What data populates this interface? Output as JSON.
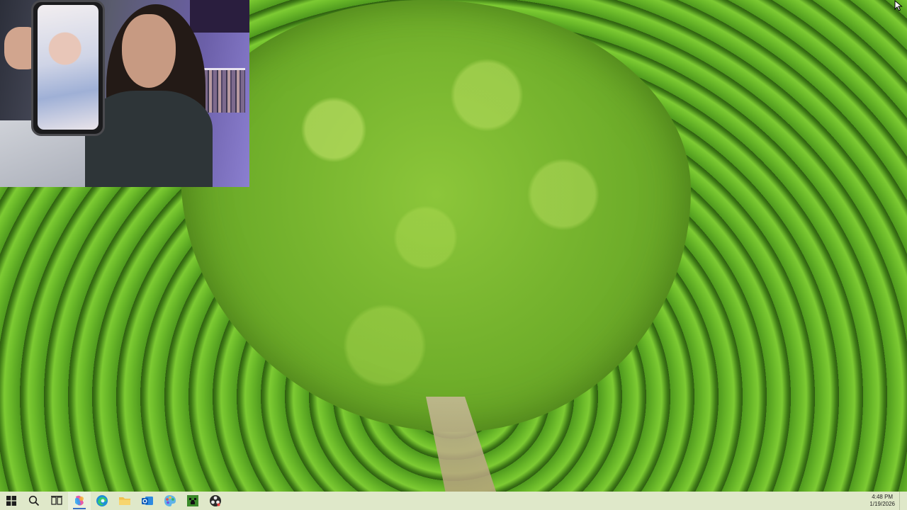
{
  "desktop": {
    "wallpaper": "aerial-tree-tea-field",
    "overlay": "webcam-feed"
  },
  "taskbar": {
    "items": [
      {
        "name": "start-button",
        "icon": "windows-logo-icon"
      },
      {
        "name": "search-button",
        "icon": "search-icon"
      },
      {
        "name": "task-view-button",
        "icon": "task-view-icon"
      },
      {
        "name": "copilot-app",
        "icon": "copilot-icon"
      },
      {
        "name": "edge-app",
        "icon": "edge-browser-icon"
      },
      {
        "name": "file-explorer-app",
        "icon": "folder-icon"
      },
      {
        "name": "outlook-app",
        "icon": "outlook-icon"
      },
      {
        "name": "paint-app",
        "icon": "paint-icon"
      },
      {
        "name": "minecraft-app",
        "icon": "minecraft-icon"
      },
      {
        "name": "obs-app",
        "icon": "obs-icon"
      }
    ],
    "clock": {
      "time": "4:48 PM",
      "date": "1/19/2026"
    }
  },
  "colors": {
    "taskbar_bg": "#dfe8c9",
    "accent": "#3b6fc2"
  }
}
